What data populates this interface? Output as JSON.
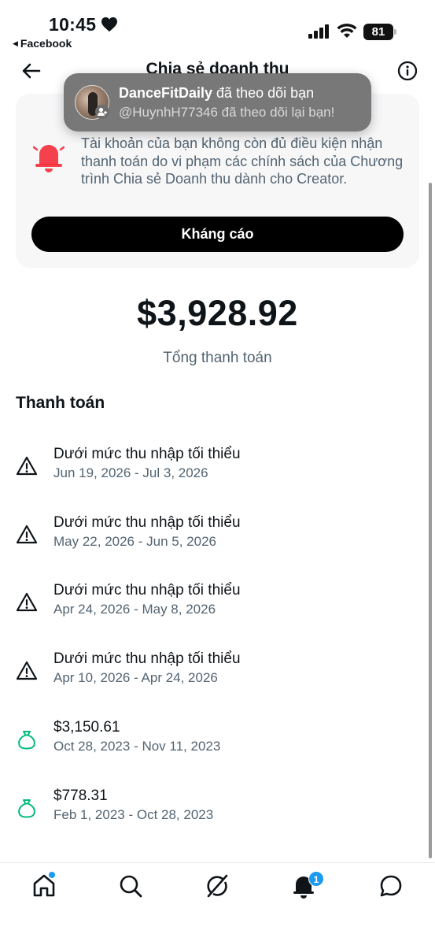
{
  "status_bar": {
    "time": "10:45",
    "back_app": "Facebook",
    "battery": "81"
  },
  "header": {
    "title": "Chia sẻ doanh thu"
  },
  "toast": {
    "name": "DanceFitDaily",
    "action": " đã theo dõi bạn",
    "subtitle": "@HuynhH77346 đã theo dõi lại bạn!"
  },
  "notice": {
    "message": "Tài khoản của bạn không còn đủ điều kiện nhận thanh toán do vi phạm các chính sách của Chương trình Chia sẻ Doanh thu dành cho Creator.",
    "button_label": "Kháng cáo",
    "accent_color": "#f4212e"
  },
  "summary": {
    "total": "$3,928.92",
    "total_label": "Tổng thanh toán"
  },
  "payments": {
    "section_title": "Thanh toán",
    "items": [
      {
        "icon": "warning-icon",
        "title": "Dưới mức thu nhập tối thiểu",
        "dates": "Jun 19, 2026 - Jul 3, 2026"
      },
      {
        "icon": "warning-icon",
        "title": "Dưới mức thu nhập tối thiểu",
        "dates": "May 22, 2026 - Jun 5, 2026"
      },
      {
        "icon": "warning-icon",
        "title": "Dưới mức thu nhập tối thiểu",
        "dates": "Apr 24, 2026 - May 8, 2026"
      },
      {
        "icon": "warning-icon",
        "title": "Dưới mức thu nhập tối thiểu",
        "dates": "Apr 10, 2026 - Apr 24, 2026"
      },
      {
        "icon": "money-bag-icon",
        "title": "$3,150.61",
        "dates": "Oct 28, 2023 - Nov 11, 2023"
      },
      {
        "icon": "money-bag-icon",
        "title": "$778.31",
        "dates": "Feb 1, 2023 - Oct 28, 2023"
      }
    ],
    "money_color": "#00ba7c"
  },
  "tabbar": {
    "items": [
      "home-icon",
      "search-icon",
      "grok-icon",
      "notifications-icon",
      "messages-icon"
    ],
    "notifications_count": "1",
    "accent_color": "#1d9bf0"
  }
}
